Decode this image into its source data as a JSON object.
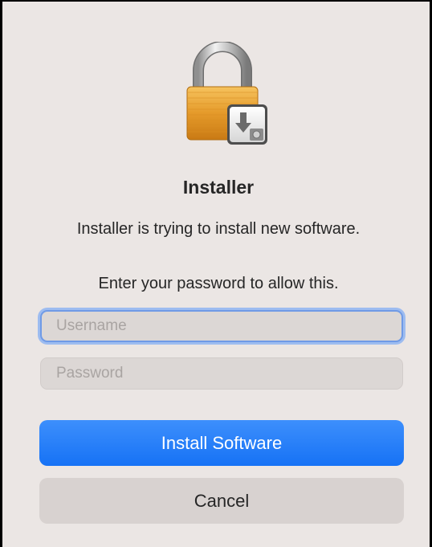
{
  "dialog": {
    "icon": "installer-lock-icon",
    "title": "Installer",
    "message": "Installer is trying to install new software.",
    "prompt": "Enter your password to allow this."
  },
  "fields": {
    "username": {
      "placeholder": "Username",
      "value": ""
    },
    "password": {
      "placeholder": "Password",
      "value": ""
    }
  },
  "buttons": {
    "install_label": "Install Software",
    "cancel_label": "Cancel"
  },
  "colors": {
    "accent": "#1672f5",
    "background": "#ebe6e4",
    "focus_ring": "#6f9ae6"
  }
}
